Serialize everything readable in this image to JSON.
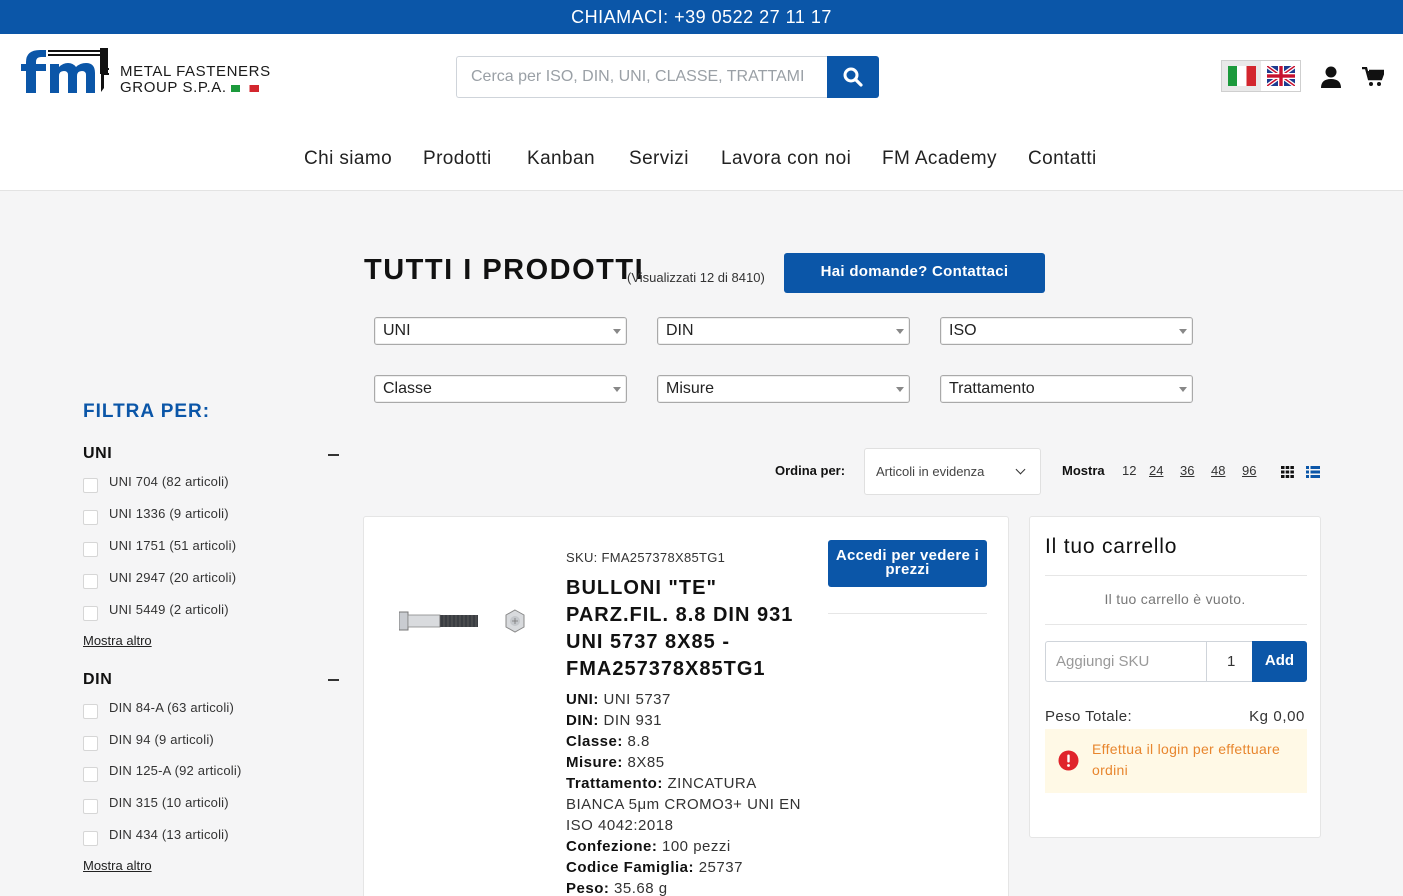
{
  "topbar": {
    "text": "CHIAMACI: +39 0522 27 11 17"
  },
  "logo": {
    "line1": "METAL FASTENERS",
    "line2": "GROUP S.P.A.",
    "mark": "fm"
  },
  "search": {
    "placeholder": "Cerca per ISO, DIN, UNI, CLASSE, TRATTAMI"
  },
  "nav": [
    "Chi siamo",
    "Prodotti",
    "Kanban",
    "Servizi",
    "Lavora con noi",
    "FM Academy",
    "Contatti"
  ],
  "page": {
    "title": "TUTTI I PRODOTTI",
    "count": "(Visualizzati 12 di 8410)",
    "contact_button": "Hai domande? Contattaci"
  },
  "selects": [
    "UNI",
    "DIN",
    "ISO",
    "Classe",
    "Misure",
    "Trattamento"
  ],
  "filters": {
    "title": "FILTRA PER:",
    "groups": [
      {
        "name": "UNI",
        "items": [
          "UNI 704 (82 articoli)",
          "UNI 1336 (9 articoli)",
          "UNI 1751 (51 articoli)",
          "UNI 2947 (20 articoli)",
          "UNI 5449 (2 articoli)"
        ],
        "more": "Mostra altro"
      },
      {
        "name": "DIN",
        "items": [
          "DIN 84-A (63 articoli)",
          "DIN 94 (9 articoli)",
          "DIN 125-A (92 articoli)",
          "DIN 315 (10 articoli)",
          "DIN 434 (13 articoli)"
        ],
        "more": "Mostra altro"
      }
    ]
  },
  "toolbar": {
    "sort_label": "Ordina per:",
    "sort_value": "Articoli in evidenza",
    "show_label": "Mostra",
    "show_options": [
      "12",
      "24",
      "36",
      "48",
      "96"
    ]
  },
  "product": {
    "sku": "SKU: FMA257378X85TG1",
    "name": "BULLONI \"TE\" PARZ.FIL. 8.8 DIN 931 UNI 5737 8X85 - FMA257378X85TG1",
    "login_button": "Accedi per vedere i prezzi",
    "specs": [
      {
        "label": "UNI:",
        "value": "UNI 5737"
      },
      {
        "label": "DIN:",
        "value": "DIN 931"
      },
      {
        "label": "Classe:",
        "value": "8.8"
      },
      {
        "label": "Misure:",
        "value": "8X85"
      },
      {
        "label": "Trattamento:",
        "value": "ZINCATURA BIANCA 5μm CROMO3+ UNI EN ISO 4042:2018"
      },
      {
        "label": "Confezione:",
        "value": "100 pezzi"
      },
      {
        "label": "Codice Famiglia:",
        "value": "25737"
      },
      {
        "label": "Peso:",
        "value": "35.68 g"
      }
    ]
  },
  "cart": {
    "title": "Il tuo carrello",
    "empty": "Il tuo carrello è vuoto.",
    "sku_placeholder": "Aggiungi SKU",
    "qty": "1",
    "add": "Add",
    "weight_label": "Peso Totale:",
    "weight_value": "Kg 0,00",
    "alert": "Effettua il login per effettuare ordini"
  },
  "colors": {
    "brand": "#0b56a8",
    "alert_text": "#e8862e",
    "alert_bg": "#fff9e6",
    "alert_icon": "#e0242b"
  },
  "icons": [
    "search-icon",
    "user-icon",
    "cart-icon",
    "grid-view-icon",
    "list-view-icon",
    "alert-icon",
    "flag-it-icon",
    "flag-uk-icon"
  ]
}
